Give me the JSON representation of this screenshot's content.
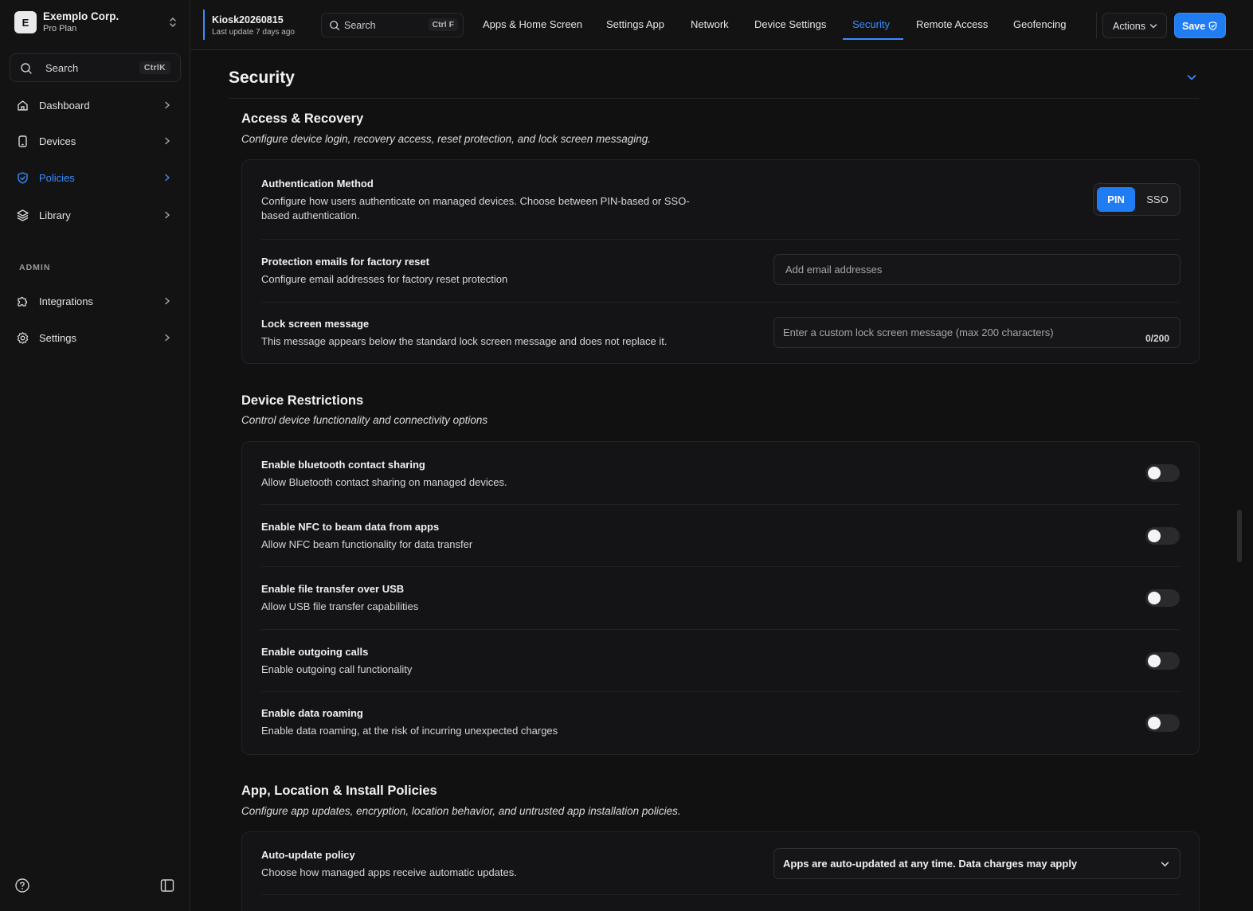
{
  "colors": {
    "accent": "#1f7cf2",
    "background": "#111112",
    "toggle_off": "#2a2a2e"
  },
  "org": {
    "initial": "E",
    "name": "Exemplo Corp.",
    "plan": "Pro Plan"
  },
  "sidebar": {
    "search_label": "Search",
    "search_shortcut": "CtrlK",
    "items": [
      {
        "label": "Dashboard",
        "icon": "home-icon"
      },
      {
        "label": "Devices",
        "icon": "device-icon"
      },
      {
        "label": "Policies",
        "icon": "shield-icon",
        "active": true
      },
      {
        "label": "Library",
        "icon": "layers-icon"
      }
    ],
    "admin_label": "ADMIN",
    "admin_items": [
      {
        "label": "Integrations",
        "icon": "puzzle-icon"
      },
      {
        "label": "Settings",
        "icon": "gear-icon"
      }
    ]
  },
  "header": {
    "policy_name": "Kiosk20260815",
    "last_update": "Last update 7 days ago",
    "search_label": "Search",
    "search_shortcut": "Ctrl F",
    "tabs": [
      {
        "label": "Apps & Home Screen"
      },
      {
        "label": "Settings App"
      },
      {
        "label": "Network"
      },
      {
        "label": "Device Settings"
      },
      {
        "label": "Security",
        "active": true
      },
      {
        "label": "Remote Access"
      },
      {
        "label": "Geofencing"
      }
    ],
    "actions_label": "Actions",
    "save_label": "Save"
  },
  "main": {
    "section_title": "Security",
    "access": {
      "title": "Access & Recovery",
      "description": "Configure device login, recovery access, reset protection, and lock screen messaging.",
      "auth": {
        "title": "Authentication Method",
        "description": "Configure how users authenticate on managed devices. Choose between PIN-based or SSO-based authentication.",
        "options": [
          "PIN",
          "SSO"
        ],
        "selected": "PIN"
      },
      "emails": {
        "title": "Protection emails for factory reset",
        "description": "Configure email addresses for factory reset protection",
        "placeholder": "Add email addresses"
      },
      "lock": {
        "title": "Lock screen message",
        "description": "This message appears below the standard lock screen message and does not replace it.",
        "placeholder": "Enter a custom lock screen message (max 200 characters)",
        "counter": "0/200"
      }
    },
    "restrictions": {
      "title": "Device Restrictions",
      "description": "Control device functionality and connectivity options",
      "items": [
        {
          "title": "Enable bluetooth contact sharing",
          "description": "Allow Bluetooth contact sharing on managed devices.",
          "enabled": false
        },
        {
          "title": "Enable NFC to beam data from apps",
          "description": "Allow NFC beam functionality for data transfer",
          "enabled": false
        },
        {
          "title": "Enable file transfer over USB",
          "description": "Allow USB file transfer capabilities",
          "enabled": false
        },
        {
          "title": "Enable outgoing calls",
          "description": "Enable outgoing call functionality",
          "enabled": false
        },
        {
          "title": "Enable data roaming",
          "description": "Enable data roaming, at the risk of incurring unexpected charges",
          "enabled": false
        }
      ]
    },
    "app_policies": {
      "title": "App, Location & Install Policies",
      "description": "Configure app updates, encryption, location behavior, and untrusted app installation policies.",
      "auto_update": {
        "title": "Auto-update policy",
        "description": "Choose how managed apps receive automatic updates.",
        "value": "Apps are auto-updated at any time. Data charges may apply"
      }
    }
  }
}
